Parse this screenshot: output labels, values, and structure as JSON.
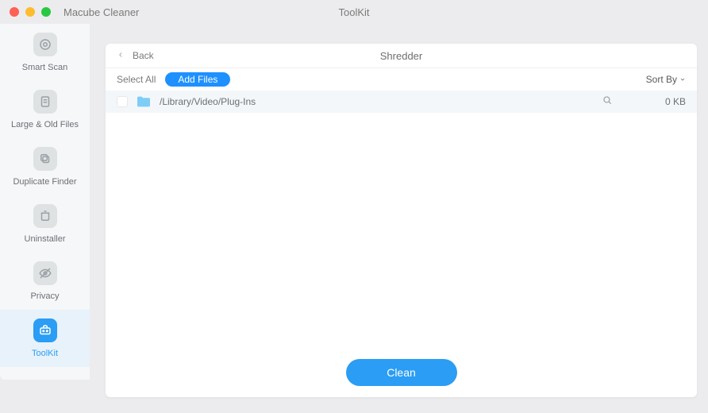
{
  "app_title": "Macube Cleaner",
  "window_title": "ToolKit",
  "sidebar": {
    "items": [
      {
        "label": "Smart Scan"
      },
      {
        "label": "Large & Old Files"
      },
      {
        "label": "Duplicate Finder"
      },
      {
        "label": "Uninstaller"
      },
      {
        "label": "Privacy"
      },
      {
        "label": "ToolKit"
      }
    ]
  },
  "modal": {
    "back_label": "Back",
    "title": "Shredder",
    "toolbar": {
      "select_all": "Select All",
      "add_files": "Add Files",
      "sort_by": "Sort By"
    },
    "files": [
      {
        "path": "/Library/Video/Plug-Ins",
        "size": "0 KB"
      }
    ],
    "clean_label": "Clean"
  }
}
